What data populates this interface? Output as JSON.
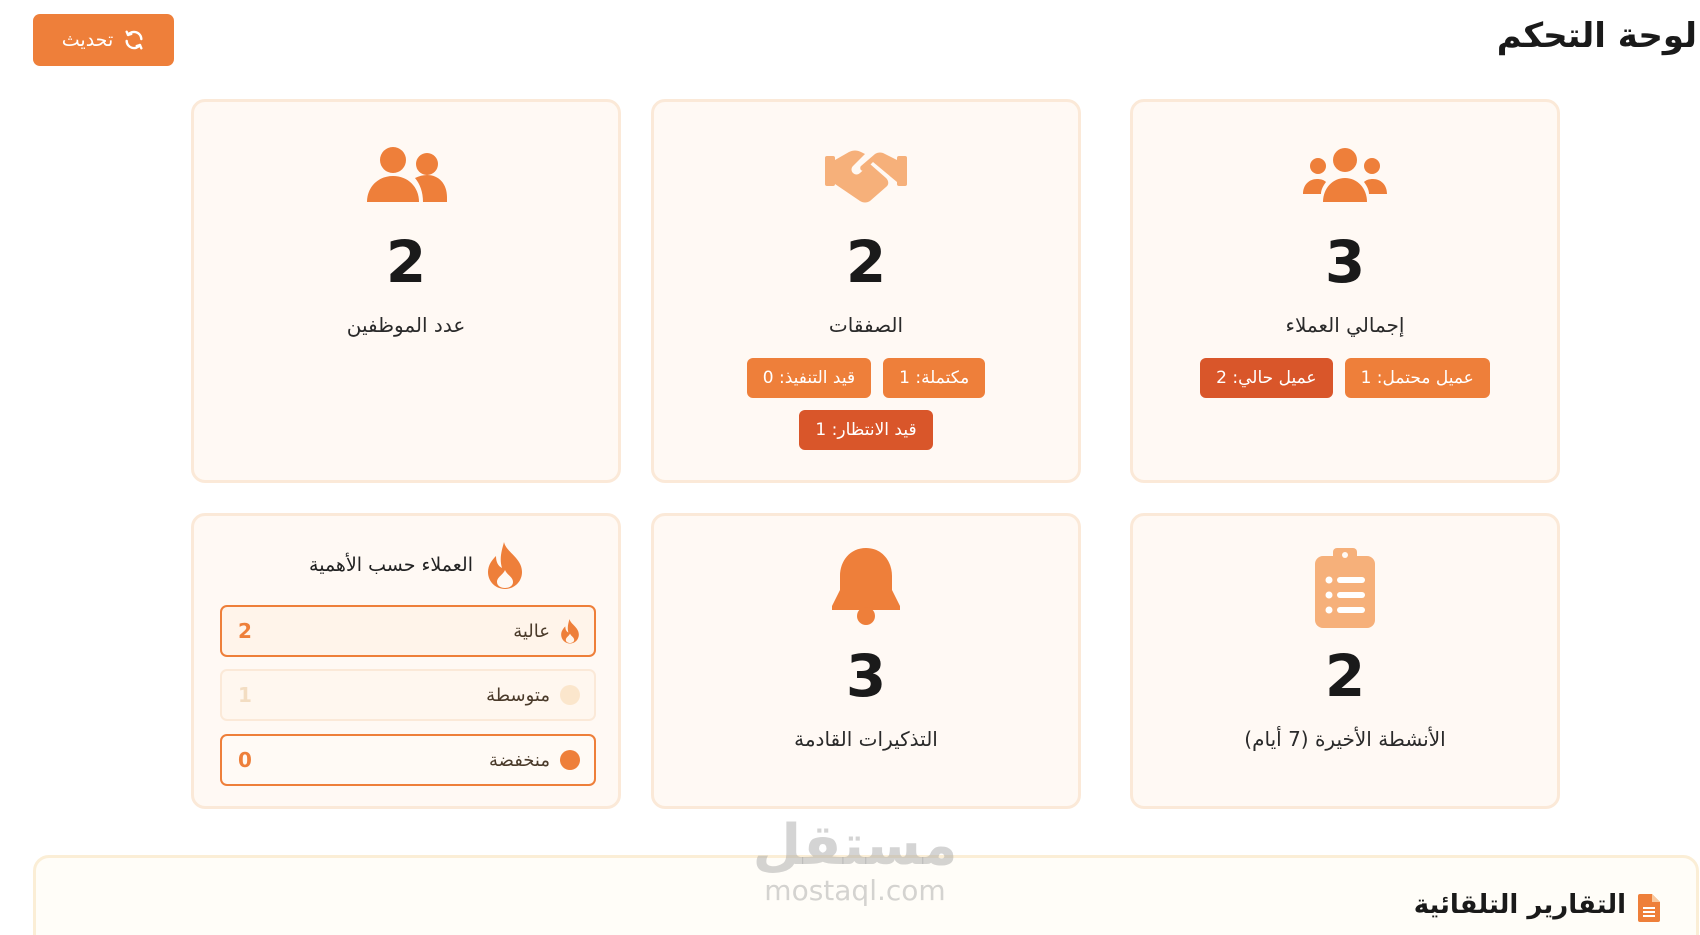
{
  "header": {
    "title": "لوحة التحكم",
    "refresh_label": "تحديث"
  },
  "cards": {
    "clients": {
      "value": "3",
      "label": "إجمالي العملاء",
      "badges": [
        "عميل محتمل: 1",
        "عميل حالي: 2"
      ]
    },
    "deals": {
      "value": "2",
      "label": "الصفقات",
      "badges": [
        "مكتملة: 1",
        "قيد التنفيذ: 0",
        "قيد الانتظار: 1"
      ]
    },
    "employees": {
      "value": "2",
      "label": "عدد الموظفين"
    },
    "activities": {
      "value": "2",
      "label": "الأنشطة الأخيرة (7 أيام)"
    },
    "reminders": {
      "value": "3",
      "label": "التذكيرات القادمة"
    },
    "priority": {
      "title": "العملاء حسب الأهمية",
      "rows": [
        {
          "name": "عالية",
          "count": "2"
        },
        {
          "name": "متوسطة",
          "count": "1"
        },
        {
          "name": "منخفضة",
          "count": "0"
        }
      ]
    }
  },
  "reports": {
    "title": "التقارير التلقائية"
  },
  "watermark": {
    "arabic": "مستقل",
    "latin": "mostaql.com"
  },
  "colors": {
    "accent": "#ee7f3a",
    "accent_dark": "#d9562a",
    "card_bg": "#fff9f4",
    "card_border": "#fbe9d8"
  }
}
